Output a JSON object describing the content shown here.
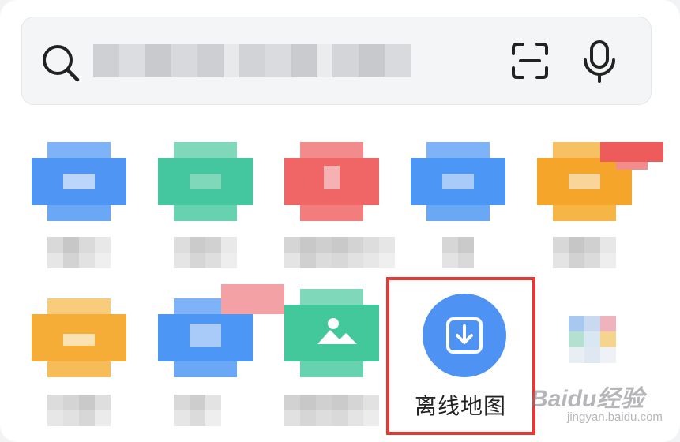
{
  "search": {
    "placeholder": "",
    "icons": [
      "search-icon",
      "scan-icon",
      "microphone-icon"
    ]
  },
  "apps": [
    {
      "row": 1,
      "col": 1,
      "color": "#4c94f5",
      "label": ""
    },
    {
      "row": 1,
      "col": 2,
      "color": "#42c9a0",
      "label": ""
    },
    {
      "row": 1,
      "col": 3,
      "color": "#f06565",
      "label": ""
    },
    {
      "row": 1,
      "col": 4,
      "color": "#4b97f6",
      "label": ""
    },
    {
      "row": 1,
      "col": 5,
      "color": "#f5a623",
      "label": ""
    },
    {
      "row": 2,
      "col": 1,
      "color": "#f5ac35",
      "label": ""
    },
    {
      "row": 2,
      "col": 2,
      "color": "#4b97f6",
      "label": ""
    },
    {
      "row": 2,
      "col": 3,
      "color": "#43c89c",
      "label": ""
    },
    {
      "row": 2,
      "col": 4,
      "color": "#4e93f3",
      "label": "离线地图",
      "highlighted": true
    },
    {
      "row": 2,
      "col": 5,
      "color": "#dfe8f2",
      "label": ""
    }
  ],
  "offline_map": {
    "label": "离线地图",
    "icon": "download-icon"
  },
  "watermark": {
    "text": "Baidu经验",
    "subtext": "jingyan.baidu.com"
  },
  "colors": {
    "highlight_border": "#e53935",
    "accent": "#4e93f3"
  }
}
